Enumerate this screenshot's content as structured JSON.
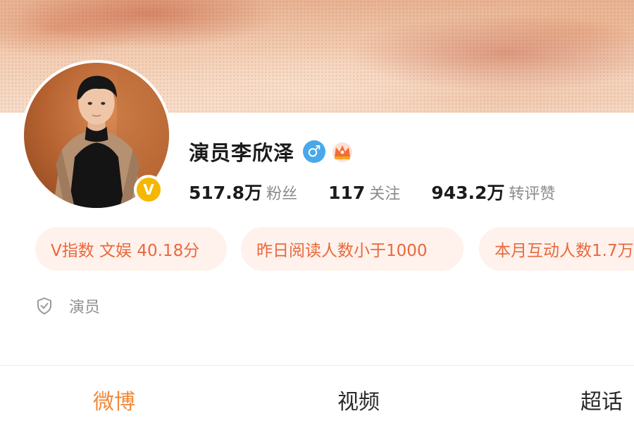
{
  "profile": {
    "name": "演员李欣泽",
    "gender_icon": "♂",
    "verified_badge": "V"
  },
  "stats": [
    {
      "number": "517.8万",
      "label": "粉丝"
    },
    {
      "number": "117",
      "label": "关注"
    },
    {
      "number": "943.2万",
      "label": "转评赞"
    }
  ],
  "pills": [
    {
      "label": "V指数 文娱 40.18分"
    },
    {
      "label": "昨日阅读人数小于1000"
    },
    {
      "label": "本月互动人数1.7万"
    }
  ],
  "description": {
    "icon": "shield-check-icon",
    "text": "演员"
  },
  "tabs": [
    {
      "label": "微博",
      "active": true
    },
    {
      "label": "视频",
      "active": false
    },
    {
      "label": "超话",
      "active": false
    }
  ],
  "colors": {
    "accent": "#f08a3c",
    "pill_text": "#e8693e",
    "pill_bg": "#fff1ec",
    "verified": "#f5b700",
    "gender": "#4aa8ea"
  }
}
